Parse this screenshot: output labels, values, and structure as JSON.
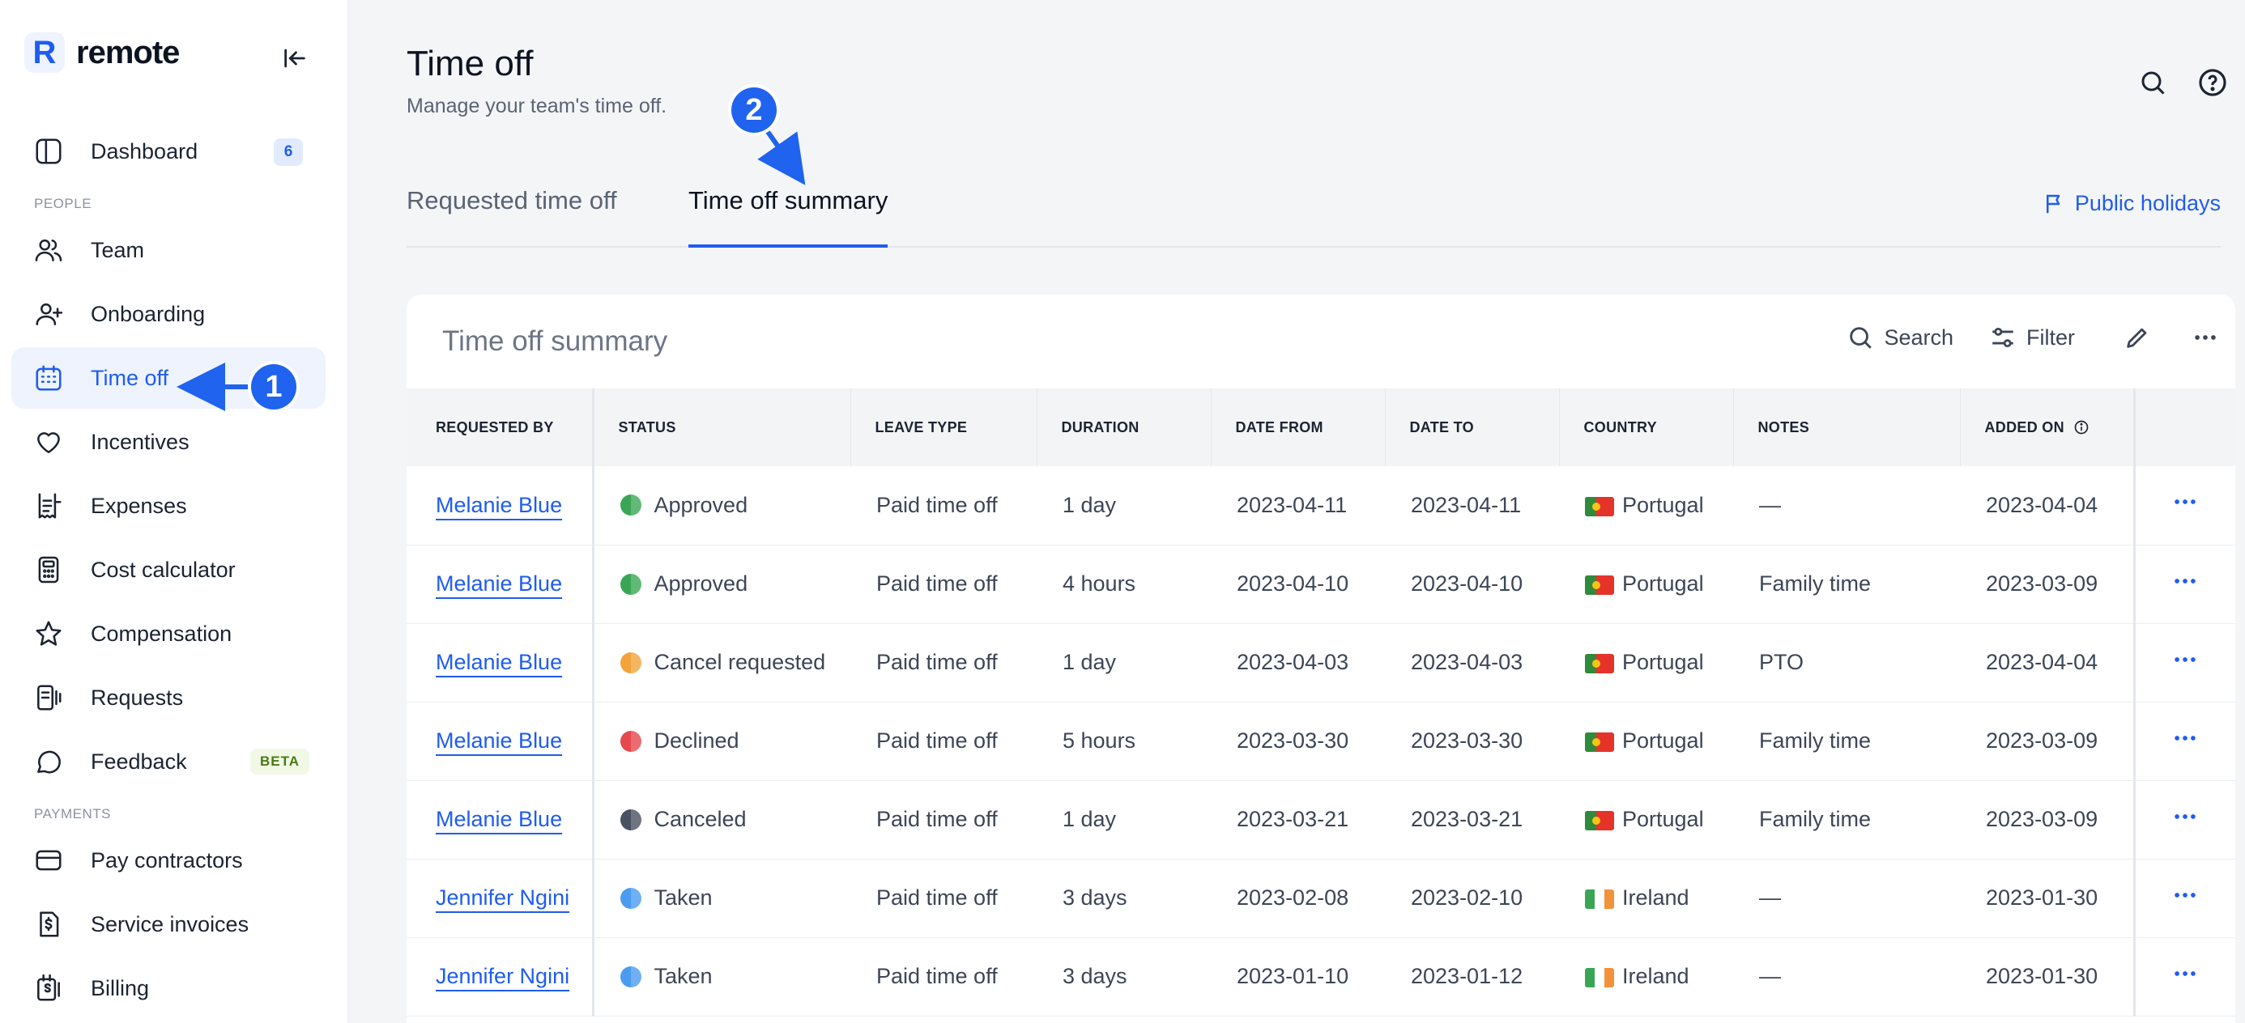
{
  "brand": {
    "name": "remote",
    "logo_letter": "R"
  },
  "sidebar": {
    "items": [
      {
        "label": "Dashboard",
        "icon": "dashboard-icon",
        "badge": "6"
      },
      {
        "section": "PEOPLE"
      },
      {
        "label": "Team",
        "icon": "team-icon"
      },
      {
        "label": "Onboarding",
        "icon": "user-plus-icon"
      },
      {
        "label": "Time off",
        "icon": "calendar-icon",
        "active": true
      },
      {
        "label": "Incentives",
        "icon": "heart-icon"
      },
      {
        "label": "Expenses",
        "icon": "receipt-icon"
      },
      {
        "label": "Cost calculator",
        "icon": "calculator-icon"
      },
      {
        "label": "Compensation",
        "icon": "star-icon"
      },
      {
        "label": "Requests",
        "icon": "requests-icon"
      },
      {
        "label": "Feedback",
        "icon": "chat-icon",
        "tag": "BETA"
      },
      {
        "section": "PAYMENTS"
      },
      {
        "label": "Pay contractors",
        "icon": "card-icon"
      },
      {
        "label": "Service invoices",
        "icon": "invoice-icon"
      },
      {
        "label": "Billing",
        "icon": "billing-icon"
      }
    ]
  },
  "header": {
    "title": "Time off",
    "subtitle": "Manage your team's time off."
  },
  "tabs": [
    {
      "label": "Requested time off",
      "active": false
    },
    {
      "label": "Time off summary",
      "active": true
    }
  ],
  "public_holidays_label": "Public holidays",
  "card": {
    "title": "Time off summary",
    "search_label": "Search",
    "filter_label": "Filter"
  },
  "table": {
    "columns": [
      "REQUESTED BY",
      "STATUS",
      "LEAVE TYPE",
      "DURATION",
      "DATE FROM",
      "DATE TO",
      "COUNTRY",
      "NOTES",
      "ADDED ON",
      ""
    ],
    "rows": [
      {
        "name": "Melanie Blue",
        "status": "Approved",
        "status_color": "#3aa655",
        "leave": "Paid time off",
        "duration": "1 day",
        "from": "2023-04-11",
        "to": "2023-04-11",
        "country": "Portugal",
        "notes": "—",
        "added": "2023-04-04"
      },
      {
        "name": "Melanie Blue",
        "status": "Approved",
        "status_color": "#3aa655",
        "leave": "Paid time off",
        "duration": "4 hours",
        "from": "2023-04-10",
        "to": "2023-04-10",
        "country": "Portugal",
        "notes": "Family time",
        "added": "2023-03-09"
      },
      {
        "name": "Melanie Blue",
        "status": "Cancel requested",
        "status_color": "#f2a33a",
        "leave": "Paid time off",
        "duration": "1 day",
        "from": "2023-04-03",
        "to": "2023-04-03",
        "country": "Portugal",
        "notes": "PTO",
        "added": "2023-04-04"
      },
      {
        "name": "Melanie Blue",
        "status": "Declined",
        "status_color": "#e5484d",
        "leave": "Paid time off",
        "duration": "5 hours",
        "from": "2023-03-30",
        "to": "2023-03-30",
        "country": "Portugal",
        "notes": "Family time",
        "added": "2023-03-09"
      },
      {
        "name": "Melanie Blue",
        "status": "Canceled",
        "status_color": "#4a5160",
        "leave": "Paid time off",
        "duration": "1 day",
        "from": "2023-03-21",
        "to": "2023-03-21",
        "country": "Portugal",
        "notes": "Family time",
        "added": "2023-03-09"
      },
      {
        "name": "Jennifer Ngini",
        "status": "Taken",
        "status_color": "#4b9bf0",
        "leave": "Paid time off",
        "duration": "3 days",
        "from": "2023-02-08",
        "to": "2023-02-10",
        "country": "Ireland",
        "notes": "—",
        "added": "2023-01-30"
      },
      {
        "name": "Jennifer Ngini",
        "status": "Taken",
        "status_color": "#4b9bf0",
        "leave": "Paid time off",
        "duration": "3 days",
        "from": "2023-01-10",
        "to": "2023-01-12",
        "country": "Ireland",
        "notes": "—",
        "added": "2023-01-30"
      }
    ]
  },
  "annotations": [
    {
      "number": "1"
    },
    {
      "number": "2"
    }
  ],
  "colors": {
    "accent": "#1f5cf0",
    "marker": "#1f63ef"
  }
}
